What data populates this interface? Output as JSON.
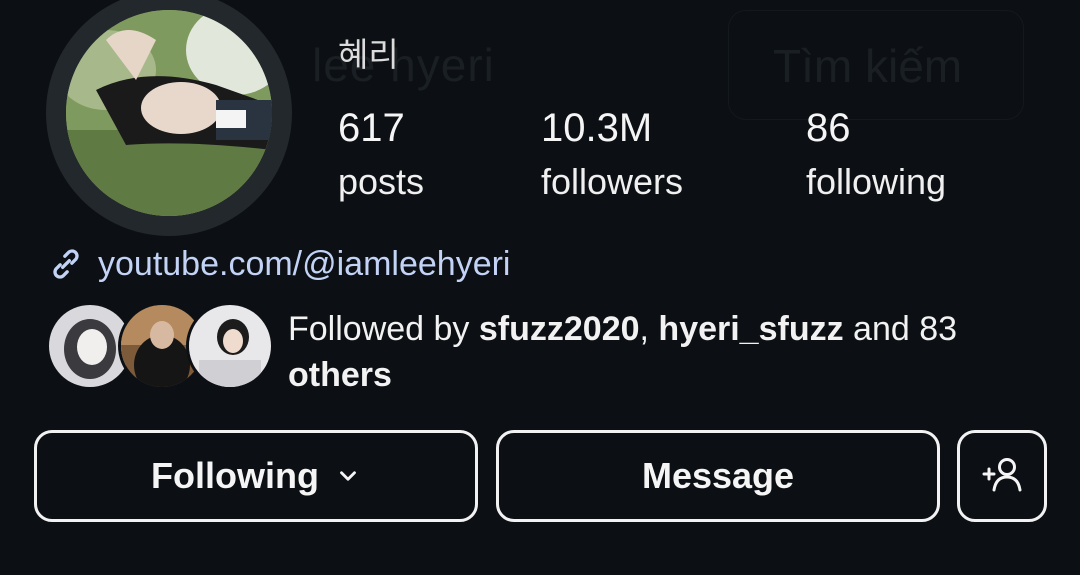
{
  "header": {
    "ghost_username": "lee hyeri",
    "ghost_search": "Tìm kiếm"
  },
  "profile": {
    "display_name": "혜리",
    "stats": {
      "posts": {
        "value": "617",
        "label": "posts"
      },
      "followers": {
        "value": "10.3M",
        "label": "followers"
      },
      "following": {
        "value": "86",
        "label": "following"
      }
    },
    "link": "youtube.com/@iamleehyeri",
    "followed_by": {
      "prefix": "Followed by ",
      "user1": "sfuzz2020",
      "sep": ", ",
      "user2": "hyeri_sfuzz",
      "and_text": " and 83",
      "others": "others"
    }
  },
  "actions": {
    "following_label": "Following",
    "message_label": "Message"
  },
  "icons": {
    "link": "link-icon",
    "chevron": "chevron-down-icon",
    "add_person": "add-person-icon"
  },
  "colors": {
    "background": "#0c1014",
    "link": "#c3d3f6",
    "text": "#f5f5f5"
  }
}
